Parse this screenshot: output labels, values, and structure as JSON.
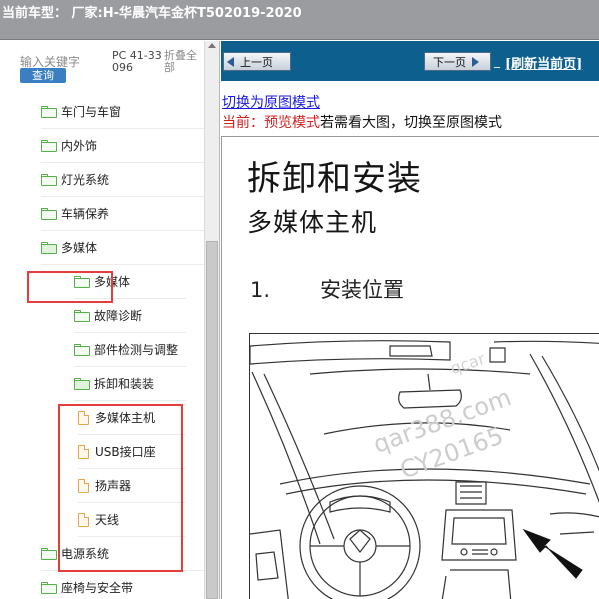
{
  "title_bar": {
    "text": "当前车型： 厂家:H-华晨汽车金杯T502019-2020"
  },
  "left_panel": {
    "keyword_label": "输入关键字",
    "query_button": "查询",
    "part_code": "PC 41-33096",
    "fold_all": "折叠全部",
    "tree": [
      {
        "label": "车门与车窗",
        "type": "folder"
      },
      {
        "label": "内外饰",
        "type": "folder"
      },
      {
        "label": "灯光系统",
        "type": "folder"
      },
      {
        "label": "车辆保养",
        "type": "folder"
      },
      {
        "label": "多媒体",
        "type": "folder-open"
      },
      {
        "label": "多媒体",
        "type": "folder"
      },
      {
        "label": "故障诊断",
        "type": "folder"
      },
      {
        "label": "部件检测与调整",
        "type": "folder"
      },
      {
        "label": "拆卸和装装",
        "type": "folder-open"
      },
      {
        "label": "多媒体主机",
        "type": "document"
      },
      {
        "label": "USB接口座",
        "type": "document"
      },
      {
        "label": "扬声器",
        "type": "document"
      },
      {
        "label": "天线",
        "type": "document"
      },
      {
        "label": "电源系统",
        "type": "folder"
      },
      {
        "label": "座椅与安全带",
        "type": "folder"
      }
    ]
  },
  "right_panel": {
    "prev_button": "上一页",
    "next_button": "下一页",
    "nav_separator": "_",
    "refresh_link": "[刷新当前页]",
    "switch_mode_link": "切换为原图模式",
    "current_label": "当前：预览模式",
    "current_hint": "若需看大图，切换至原图模式",
    "doc": {
      "heading": "拆卸和安装",
      "subheading": "多媒体主机",
      "step_number": "1.",
      "step_text": "安装位置",
      "watermark_1": "qar388.com",
      "watermark_2": "CY20165",
      "watermark_3": "qcar"
    }
  },
  "colors": {
    "titlebar": "#9b9ca0",
    "navbar": "#0d5f8d",
    "highlight": "#e53c3c",
    "folder": "#55b04a",
    "document": "#e4a64a",
    "link": "#1a1ae0",
    "current_red": "#d41f1f"
  },
  "icons": {
    "folder": "folder-icon",
    "folder_open": "folder-open-icon",
    "document": "document-icon",
    "prev": "arrow-left-icon",
    "next": "arrow-right-icon"
  }
}
